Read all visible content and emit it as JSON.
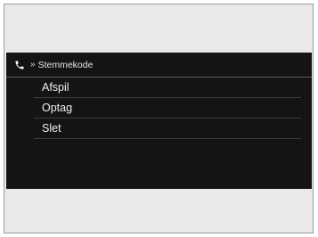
{
  "header": {
    "icon": "phone-icon",
    "chevron": "»",
    "title": "Stemmekode"
  },
  "menu": {
    "items": [
      {
        "label": "Afspil"
      },
      {
        "label": "Optag"
      },
      {
        "label": "Slet"
      }
    ]
  },
  "colors": {
    "screen_background": "#141414",
    "text": "#f0f0f0",
    "frame_background": "#e9e9e9"
  }
}
